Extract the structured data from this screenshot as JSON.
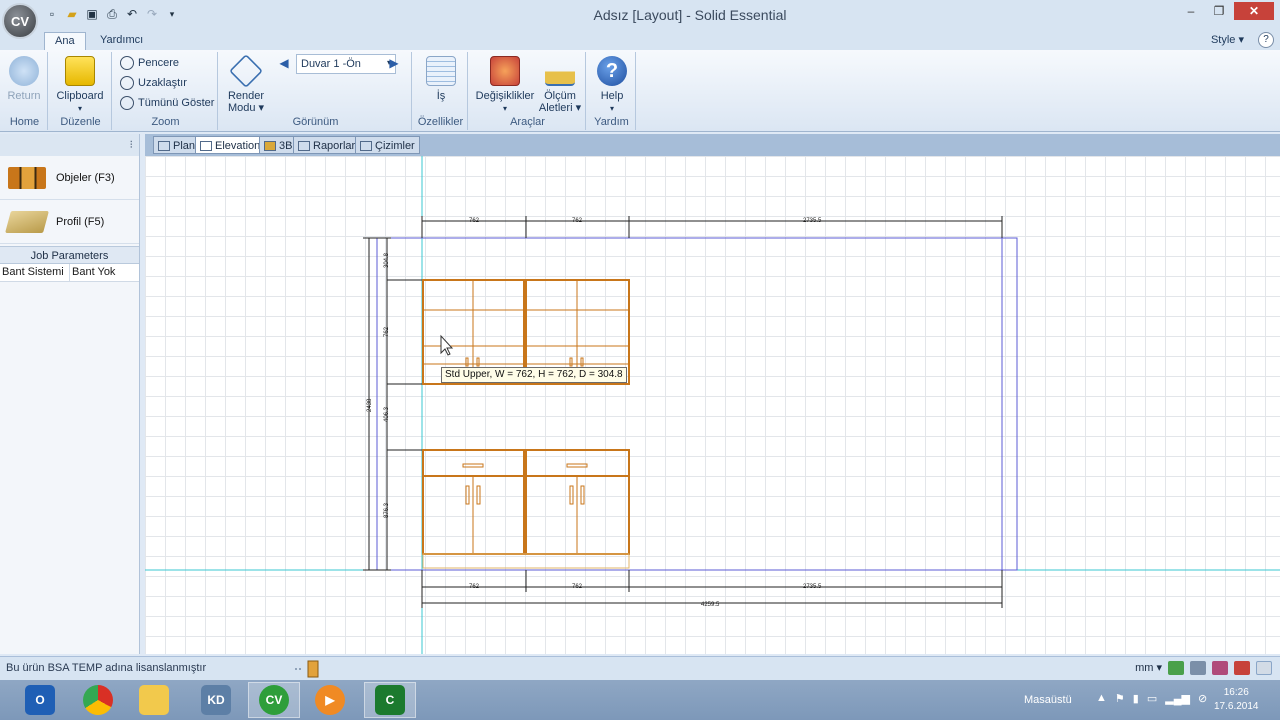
{
  "window": {
    "title": "Adsız [Layout] - Solid Essential",
    "logo_text": "CV",
    "minimize_glyph": "–",
    "maximize_glyph": "❐",
    "close_glyph": "✕"
  },
  "ribbon_tabs": [
    {
      "label": "Ana",
      "active": true
    },
    {
      "label": "Yardımcı",
      "active": false
    }
  ],
  "style_menu": "Style",
  "ribbon": {
    "home": {
      "button": "Return",
      "group": "Home"
    },
    "edit": {
      "button": "Clipboard",
      "group": "Düzenle"
    },
    "zoom": {
      "items": [
        "Pencere",
        "Uzaklaştır",
        "Tümünü Göster"
      ],
      "group": "Zoom"
    },
    "view": {
      "render_line1": "Render",
      "render_line2": "Modu",
      "wall_selector": "Duvar 1 -Ön",
      "group": "Görünüm"
    },
    "props": {
      "button": "İş",
      "group": "Özellikler"
    },
    "tools": {
      "changes": "Değişiklikler",
      "measure_line1": "Ölçüm",
      "measure_line2": "Aletleri",
      "group": "Araçlar"
    },
    "help": {
      "button": "Help",
      "group": "Yardım"
    }
  },
  "view_tabs": [
    {
      "label": "Plan",
      "active": false
    },
    {
      "label": "Elevation",
      "active": true
    },
    {
      "label": "3B",
      "active": false
    },
    {
      "label": "Raporlar",
      "active": false
    },
    {
      "label": "Çizimler",
      "active": false
    }
  ],
  "left_panel": {
    "objects_button": "Objeler (F3)",
    "profile_button": "Profil (F5)",
    "job_params_title": "Job Parameters",
    "job_params": [
      {
        "key": "Bant Sistemi",
        "value": "Bant Yok"
      }
    ]
  },
  "drawing": {
    "tooltip": "Std Upper, W = 762, H = 762, D = 304.8",
    "top_dims": [
      "762",
      "762",
      "2735.5"
    ],
    "bottom_dims": [
      "762",
      "762",
      "2735.5"
    ],
    "total_dim": "4259.5",
    "left_dims": [
      "304.8",
      "762",
      "406.3",
      "876.3"
    ],
    "overall_height": "2438"
  },
  "status_bar": {
    "license_text": "Bu ürün BSA TEMP adına lisanslanmıştır",
    "units": "mm"
  },
  "taskbar": {
    "desktop_label": "Masaüstü",
    "time": "16:26",
    "date": "17.6.2014",
    "apps": [
      "outlook-app",
      "chrome-app",
      "explorer-app",
      "remote-app",
      "cv-app",
      "media-app",
      "cabinet-app"
    ]
  },
  "colors": {
    "cabinet": "#c8761a",
    "wall": "#5b5bd6",
    "guide": "#38c7d2",
    "accent_red": "#c7423a"
  }
}
